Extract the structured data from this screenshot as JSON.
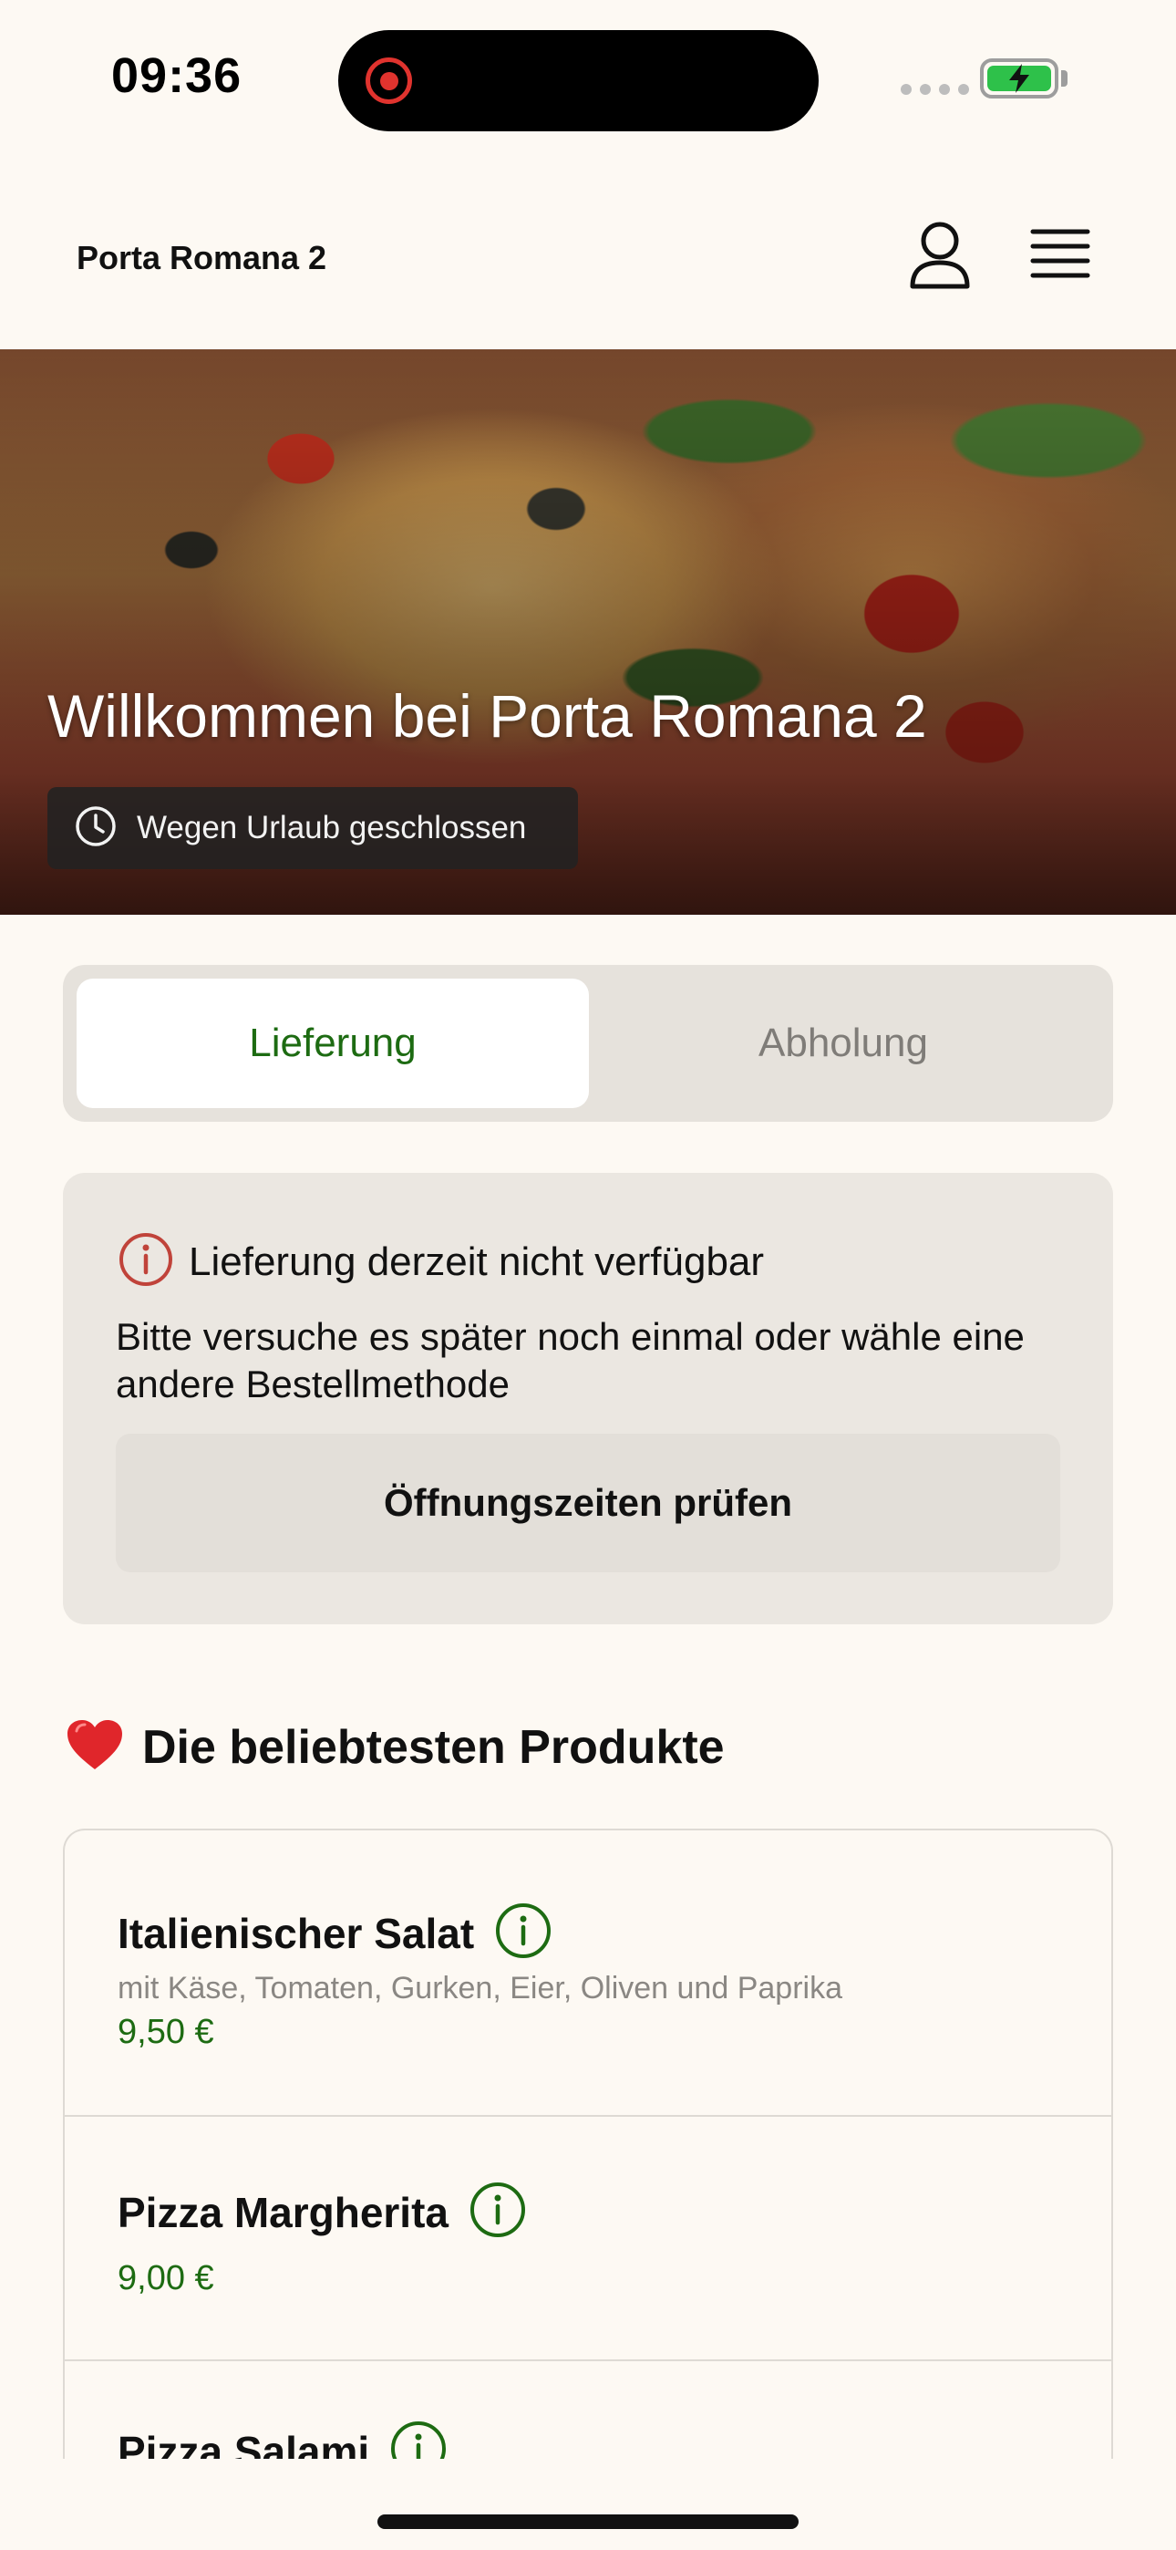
{
  "status_bar": {
    "time": "09:36",
    "icons": [
      "screen-recording-icon",
      "signal-icon",
      "battery-charging-icon"
    ]
  },
  "header": {
    "title": "Porta Romana 2",
    "icons": [
      "user-icon",
      "menu-icon"
    ]
  },
  "hero": {
    "title": "Willkommen bei Porta Romana 2",
    "status": "Wegen Urlaub geschlossen",
    "status_icon": "clock-icon"
  },
  "order_mode": {
    "tabs": [
      {
        "label": "Lieferung",
        "selected": true
      },
      {
        "label": "Abholung",
        "selected": false
      }
    ]
  },
  "notice": {
    "icon": "info-alert-icon",
    "title": "Lieferung derzeit nicht verfügbar",
    "body": "Bitte versuche es später noch einmal oder wähle eine andere Bestellmethode",
    "button_label": "Öffnungszeiten prüfen"
  },
  "popular": {
    "emoji": "❤️",
    "title": "Die beliebtesten Produkte",
    "products": [
      {
        "name": "Italienischer Salat",
        "description": "mit Käse, Tomaten, Gurken, Eier, Oliven und Paprika",
        "price": "9,50 €"
      },
      {
        "name": "Pizza Margherita",
        "description": "",
        "price": "9,00 €"
      },
      {
        "name": "Pizza Salami",
        "description": "",
        "price": ""
      }
    ]
  },
  "colors": {
    "background": "#FDF9F3",
    "accent_green": "#1D6B12",
    "alert_red": "#C0433A",
    "card_grey": "#EBE7E1"
  }
}
